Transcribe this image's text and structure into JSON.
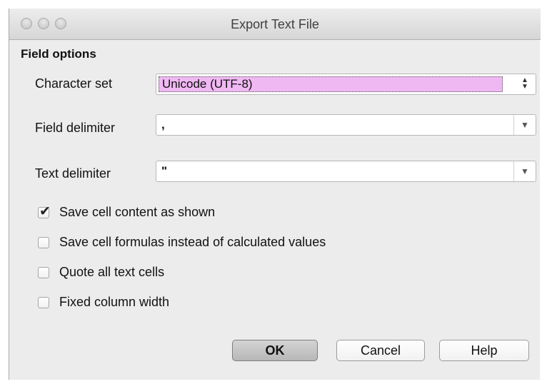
{
  "window": {
    "title": "Export Text File"
  },
  "section_title": "Field options",
  "fields": {
    "character_set": {
      "label": "Character set",
      "value": "Unicode (UTF-8)"
    },
    "field_delimiter": {
      "label": "Field delimiter",
      "value": ","
    },
    "text_delimiter": {
      "label": "Text delimiter",
      "value": "\""
    }
  },
  "options": [
    {
      "label": "Save cell content as shown",
      "checked": true
    },
    {
      "label": "Save cell formulas instead of calculated values",
      "checked": false
    },
    {
      "label": "Quote all text cells",
      "checked": false
    },
    {
      "label": "Fixed column width",
      "checked": false
    }
  ],
  "buttons": {
    "ok": "OK",
    "cancel": "Cancel",
    "help": "Help"
  },
  "icons": {
    "checkmark": "✔",
    "dropdown": "▼",
    "updown_up": "▲",
    "updown_down": "▼"
  },
  "colors": {
    "selection_highlight": "#f0b8f3",
    "window_bg": "#ececec"
  }
}
